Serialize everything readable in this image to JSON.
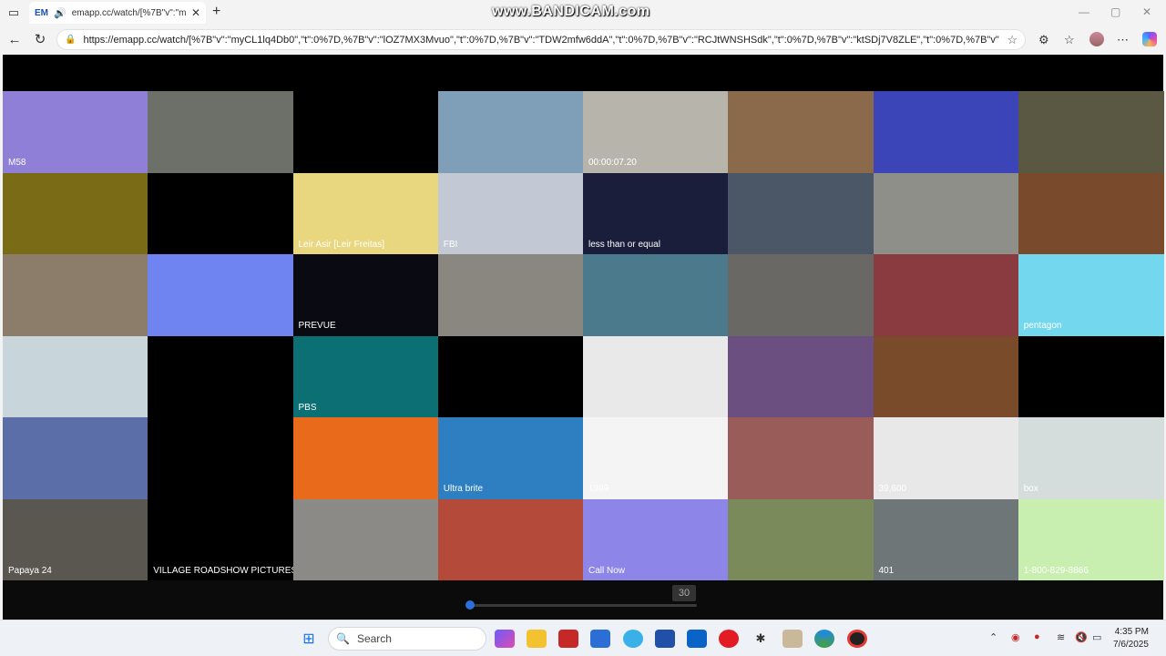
{
  "browser": {
    "tab": {
      "favicon": "EM",
      "title": "emapp.cc/watch/[%7B\"v\":\"m"
    },
    "address_url": "https://emapp.cc/watch/[%7B\"v\":\"myCL1lq4Db0\",\"t\":0%7D,%7B\"v\":\"lOZ7MX3Mvuo\",\"t\":0%7D,%7B\"v\":\"TDW2mfw6ddA\",\"t\":0%7D,%7B\"v\":\"RCJtWNSHSdk\",\"t\":0%7D,%7B\"v\":\"ktSDj7V8ZLE\",\"t\":0%7D,%7B\"v\"...",
    "icons": [
      "sidebar-icon",
      "speaker-icon",
      "close-icon",
      "plus-icon",
      "back-icon",
      "refresh-icon",
      "site-info-icon",
      "favorite-star-icon",
      "extensions-icon",
      "favorites-icon",
      "profile-avatar",
      "more-icon",
      "copilot-icon"
    ]
  },
  "watermark": "www.BANDICAM.com",
  "tiles": [
    {
      "id": "t1",
      "bg": "#8f7fd6",
      "text": "M58"
    },
    {
      "id": "t2",
      "bg": "#6d6f69",
      "text": ""
    },
    {
      "id": "t3",
      "bg": "#000000",
      "text": ""
    },
    {
      "id": "t4",
      "bg": "#7f9fb8",
      "text": ""
    },
    {
      "id": "t5",
      "bg": "#b7b4ab",
      "text": "00:00:07.20"
    },
    {
      "id": "t6",
      "bg": "#8a6a4b",
      "text": ""
    },
    {
      "id": "t7",
      "bg": "#3b45b8",
      "text": ""
    },
    {
      "id": "t8",
      "bg": "#5a5743",
      "text": ""
    },
    {
      "id": "t9",
      "bg": "#7a6b16",
      "text": ""
    },
    {
      "id": "t10",
      "bg": "#000000",
      "text": ""
    },
    {
      "id": "t11",
      "bg": "#e8d77e",
      "text": "Leir Asir [Leir Freitas]"
    },
    {
      "id": "t12",
      "bg": "#c2c8d4",
      "text": "FBI"
    },
    {
      "id": "t13",
      "bg": "#1a1e3a",
      "text": "less than or equal"
    },
    {
      "id": "t14",
      "bg": "#4b5666",
      "text": ""
    },
    {
      "id": "t15",
      "bg": "#8e8f88",
      "text": ""
    },
    {
      "id": "t16",
      "bg": "#7a4a2c",
      "text": ""
    },
    {
      "id": "t17",
      "bg": "#8c7d6a",
      "text": ""
    },
    {
      "id": "t18",
      "bg": "#6f84f0",
      "text": ""
    },
    {
      "id": "t19",
      "bg": "#0a0a12",
      "text": "PREVUE"
    },
    {
      "id": "t20",
      "bg": "#8a8780",
      "text": ""
    },
    {
      "id": "t21",
      "bg": "#4a7a8c",
      "text": ""
    },
    {
      "id": "t22",
      "bg": "#6a6865",
      "text": ""
    },
    {
      "id": "t23",
      "bg": "#8a3b3f",
      "text": ""
    },
    {
      "id": "t24",
      "bg": "#73d7ee",
      "text": "pentagon"
    },
    {
      "id": "t25",
      "bg": "#c8d6dc",
      "text": ""
    },
    {
      "id": "t26",
      "bg": "#000000",
      "text": ""
    },
    {
      "id": "t27",
      "bg": "#0b6f74",
      "text": "PBS"
    },
    {
      "id": "t28",
      "bg": "#000000",
      "text": ""
    },
    {
      "id": "t29",
      "bg": "#e9e9e9",
      "text": ""
    },
    {
      "id": "t30",
      "bg": "#6a4f80",
      "text": ""
    },
    {
      "id": "t31",
      "bg": "#7a4b2a",
      "text": ""
    },
    {
      "id": "t32",
      "bg": "#000000",
      "text": ""
    },
    {
      "id": "t33",
      "bg": "#5b6ea8",
      "text": ""
    },
    {
      "id": "t34",
      "bg": "#000000",
      "text": ""
    },
    {
      "id": "t35",
      "bg": "#e86a1a",
      "text": ""
    },
    {
      "id": "t36",
      "bg": "#2d7fc1",
      "text": "Ultra brite"
    },
    {
      "id": "t37",
      "bg": "#f4f4f4",
      "text": "1999"
    },
    {
      "id": "t38",
      "bg": "#9a5c58",
      "text": ""
    },
    {
      "id": "t39",
      "bg": "#e8e8e8",
      "text": "39,600"
    },
    {
      "id": "t40",
      "bg": "#d4dcdc",
      "text": "box"
    },
    {
      "id": "t41",
      "bg": "#5a5650",
      "text": "Papaya 24"
    },
    {
      "id": "t42",
      "bg": "#000000",
      "text": "VILLAGE ROADSHOW PICTURES"
    },
    {
      "id": "t43",
      "bg": "#8c8a86",
      "text": ""
    },
    {
      "id": "t44",
      "bg": "#b44a3a",
      "text": ""
    },
    {
      "id": "t45",
      "bg": "#8d86e8",
      "text": "Call Now"
    },
    {
      "id": "t46",
      "bg": "#7a8a5a",
      "text": ""
    },
    {
      "id": "t47",
      "bg": "#6e7678",
      "text": "401"
    },
    {
      "id": "t48",
      "bg": "#c9efb0",
      "text": "1-800-829-8866"
    }
  ],
  "player": {
    "time_label": "30"
  },
  "taskbar": {
    "search_placeholder": "Search",
    "clock_time": "4:35 PM",
    "clock_date": "7/6/2025"
  }
}
